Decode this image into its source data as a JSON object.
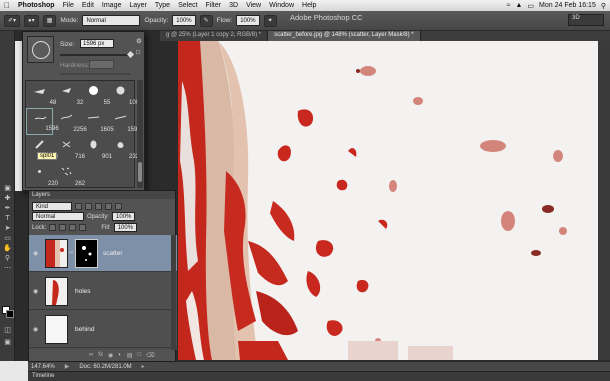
{
  "menubar": {
    "apple": "",
    "items": [
      {
        "label": "Photoshop",
        "bold": true
      },
      {
        "label": "File"
      },
      {
        "label": "Edit"
      },
      {
        "label": "Image"
      },
      {
        "label": "Layer"
      },
      {
        "label": "Type"
      },
      {
        "label": "Select"
      },
      {
        "label": "Filter"
      },
      {
        "label": "3D"
      },
      {
        "label": "View"
      },
      {
        "label": "Window"
      },
      {
        "label": "Help"
      }
    ],
    "clock": "Mon 24 Feb  16:15"
  },
  "options": {
    "mode_label": "Mode:",
    "mode_value": "Normal",
    "opacity_label": "Opacity:",
    "opacity_value": "100%",
    "flow_label": "Flow:",
    "flow_value": "100%"
  },
  "app_title": "Adobe Photoshop CC",
  "workspace": "3D",
  "doctabs": [
    {
      "label": "g @ 25% (Layer 1 copy 2, RGB/8) *",
      "active": false
    },
    {
      "label": "scatter_before.jpg @ 148% (scatter, Layer Mask/8) *",
      "active": true
    }
  ],
  "brush_panel": {
    "size_label": "Size:",
    "size_value": "1596 px",
    "hardness_label": "Hardness:",
    "brushes": [
      "48",
      "32",
      "55",
      "100",
      "1596",
      "2256",
      "1605",
      "1596",
      "124",
      "716",
      "901",
      "232",
      "220",
      "262"
    ],
    "tooltip": "spl01"
  },
  "layers_panel": {
    "title": "Layers",
    "filter_kind": "Kind",
    "blend_mode": "Normal",
    "opacity_label": "Opacity:",
    "opacity_value": "100%",
    "lock_label": "Lock:",
    "fill_label": "Fill:",
    "fill_value": "100%",
    "layers": [
      {
        "name": "scatter",
        "selected": true
      },
      {
        "name": "holes",
        "selected": false
      },
      {
        "name": "behind",
        "selected": false
      }
    ],
    "footer_icons": [
      "link-icon",
      "fx-icon",
      "mask-icon",
      "adjustment-icon",
      "folder-icon",
      "new-layer-icon",
      "trash-icon"
    ]
  },
  "status": {
    "zoom": "147.64%",
    "doc": "Doc: 60.2M/281.0M"
  },
  "timeline": "Timeline",
  "colors": {
    "accent_red": "#c8281e",
    "canvas_bg": "#f4f2f0",
    "selected_layer": "#7d90a8"
  }
}
